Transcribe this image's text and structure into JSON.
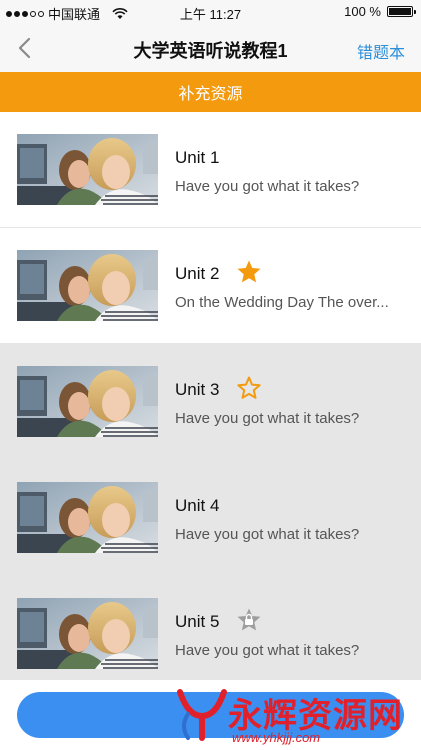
{
  "status_bar": {
    "carrier": "中国联通",
    "time": "上午 11:27",
    "battery": "100 %",
    "battery_level": 1.0
  },
  "nav": {
    "title": "大学英语听说教程1",
    "right_label": "错题本",
    "back_icon": "chevron-left-icon"
  },
  "banner": {
    "label": "补充资源"
  },
  "units": [
    {
      "title": "Unit 1",
      "subtitle": "Have you got what it takes?",
      "badge": "none"
    },
    {
      "title": "Unit 2",
      "subtitle": "On the Wedding Day The over...",
      "badge": "star-filled-icon"
    },
    {
      "title": "Unit 3",
      "subtitle": "Have you got what it takes?",
      "badge": "star-outline-icon"
    },
    {
      "title": "Unit 4",
      "subtitle": "Have you got what it takes?",
      "badge": "none"
    },
    {
      "title": "Unit 5",
      "subtitle": "Have you got what it takes?",
      "badge": "lock-icon"
    }
  ],
  "watermark": {
    "text": "永辉资源网",
    "url": "www.yhkjjj.com"
  },
  "colors": {
    "accent_orange": "#f39a0e",
    "link_blue": "#2e8fd9",
    "button_blue": "#3b8ff0",
    "star_orange": "#f39a0e"
  }
}
